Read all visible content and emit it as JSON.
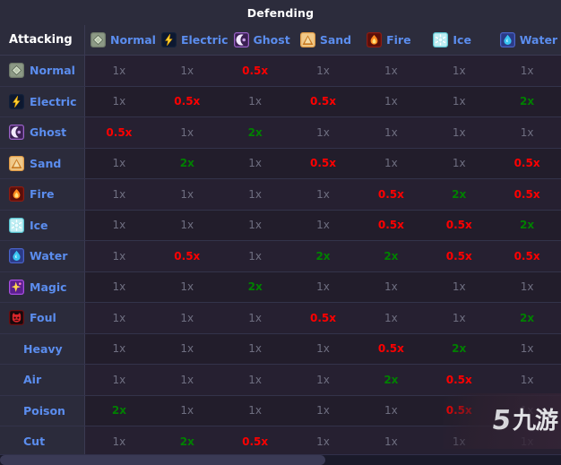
{
  "header": {
    "top_title": "Defending",
    "attacking_label": "Attacking"
  },
  "columns": [
    {
      "name": "Normal",
      "icon": "normal-icon"
    },
    {
      "name": "Electric",
      "icon": "electric-icon"
    },
    {
      "name": "Ghost",
      "icon": "ghost-icon"
    },
    {
      "name": "Sand",
      "icon": "sand-icon"
    },
    {
      "name": "Fire",
      "icon": "fire-icon"
    },
    {
      "name": "Ice",
      "icon": "ice-icon"
    },
    {
      "name": "Water",
      "icon": "water-icon"
    }
  ],
  "rows": [
    {
      "name": "Normal",
      "icon": "normal-icon",
      "values": [
        "1x",
        "1x",
        "0.5x",
        "1x",
        "1x",
        "1x",
        "1x"
      ]
    },
    {
      "name": "Electric",
      "icon": "electric-icon",
      "values": [
        "1x",
        "0.5x",
        "1x",
        "0.5x",
        "1x",
        "1x",
        "2x"
      ]
    },
    {
      "name": "Ghost",
      "icon": "ghost-icon",
      "values": [
        "0.5x",
        "1x",
        "2x",
        "1x",
        "1x",
        "1x",
        "1x"
      ]
    },
    {
      "name": "Sand",
      "icon": "sand-icon",
      "values": [
        "1x",
        "2x",
        "1x",
        "0.5x",
        "1x",
        "1x",
        "0.5x"
      ]
    },
    {
      "name": "Fire",
      "icon": "fire-icon",
      "values": [
        "1x",
        "1x",
        "1x",
        "1x",
        "0.5x",
        "2x",
        "0.5x"
      ]
    },
    {
      "name": "Ice",
      "icon": "ice-icon",
      "values": [
        "1x",
        "1x",
        "1x",
        "1x",
        "0.5x",
        "0.5x",
        "2x"
      ]
    },
    {
      "name": "Water",
      "icon": "water-icon",
      "values": [
        "1x",
        "0.5x",
        "1x",
        "2x",
        "2x",
        "0.5x",
        "0.5x"
      ]
    },
    {
      "name": "Magic",
      "icon": "magic-icon",
      "values": [
        "1x",
        "1x",
        "2x",
        "1x",
        "1x",
        "1x",
        "1x"
      ]
    },
    {
      "name": "Foul",
      "icon": "foul-icon",
      "values": [
        "1x",
        "1x",
        "1x",
        "0.5x",
        "1x",
        "1x",
        "2x"
      ]
    },
    {
      "name": "Heavy",
      "icon": null,
      "values": [
        "1x",
        "1x",
        "1x",
        "1x",
        "0.5x",
        "2x",
        "1x"
      ]
    },
    {
      "name": "Air",
      "icon": null,
      "values": [
        "1x",
        "1x",
        "1x",
        "1x",
        "2x",
        "0.5x",
        "1x"
      ]
    },
    {
      "name": "Poison",
      "icon": null,
      "values": [
        "2x",
        "1x",
        "1x",
        "1x",
        "1x",
        "0.5x",
        "1x"
      ]
    },
    {
      "name": "Cut",
      "icon": null,
      "values": [
        "1x",
        "2x",
        "0.5x",
        "1x",
        "1x",
        "1x",
        "1x"
      ]
    }
  ],
  "legend_colors": {
    "neutral": "#6e6e80",
    "not_very_effective": "#fe0000",
    "super_effective": "#008000",
    "type_label": "#5b8dee"
  },
  "watermark": {
    "mark": "5",
    "text": "九游"
  }
}
